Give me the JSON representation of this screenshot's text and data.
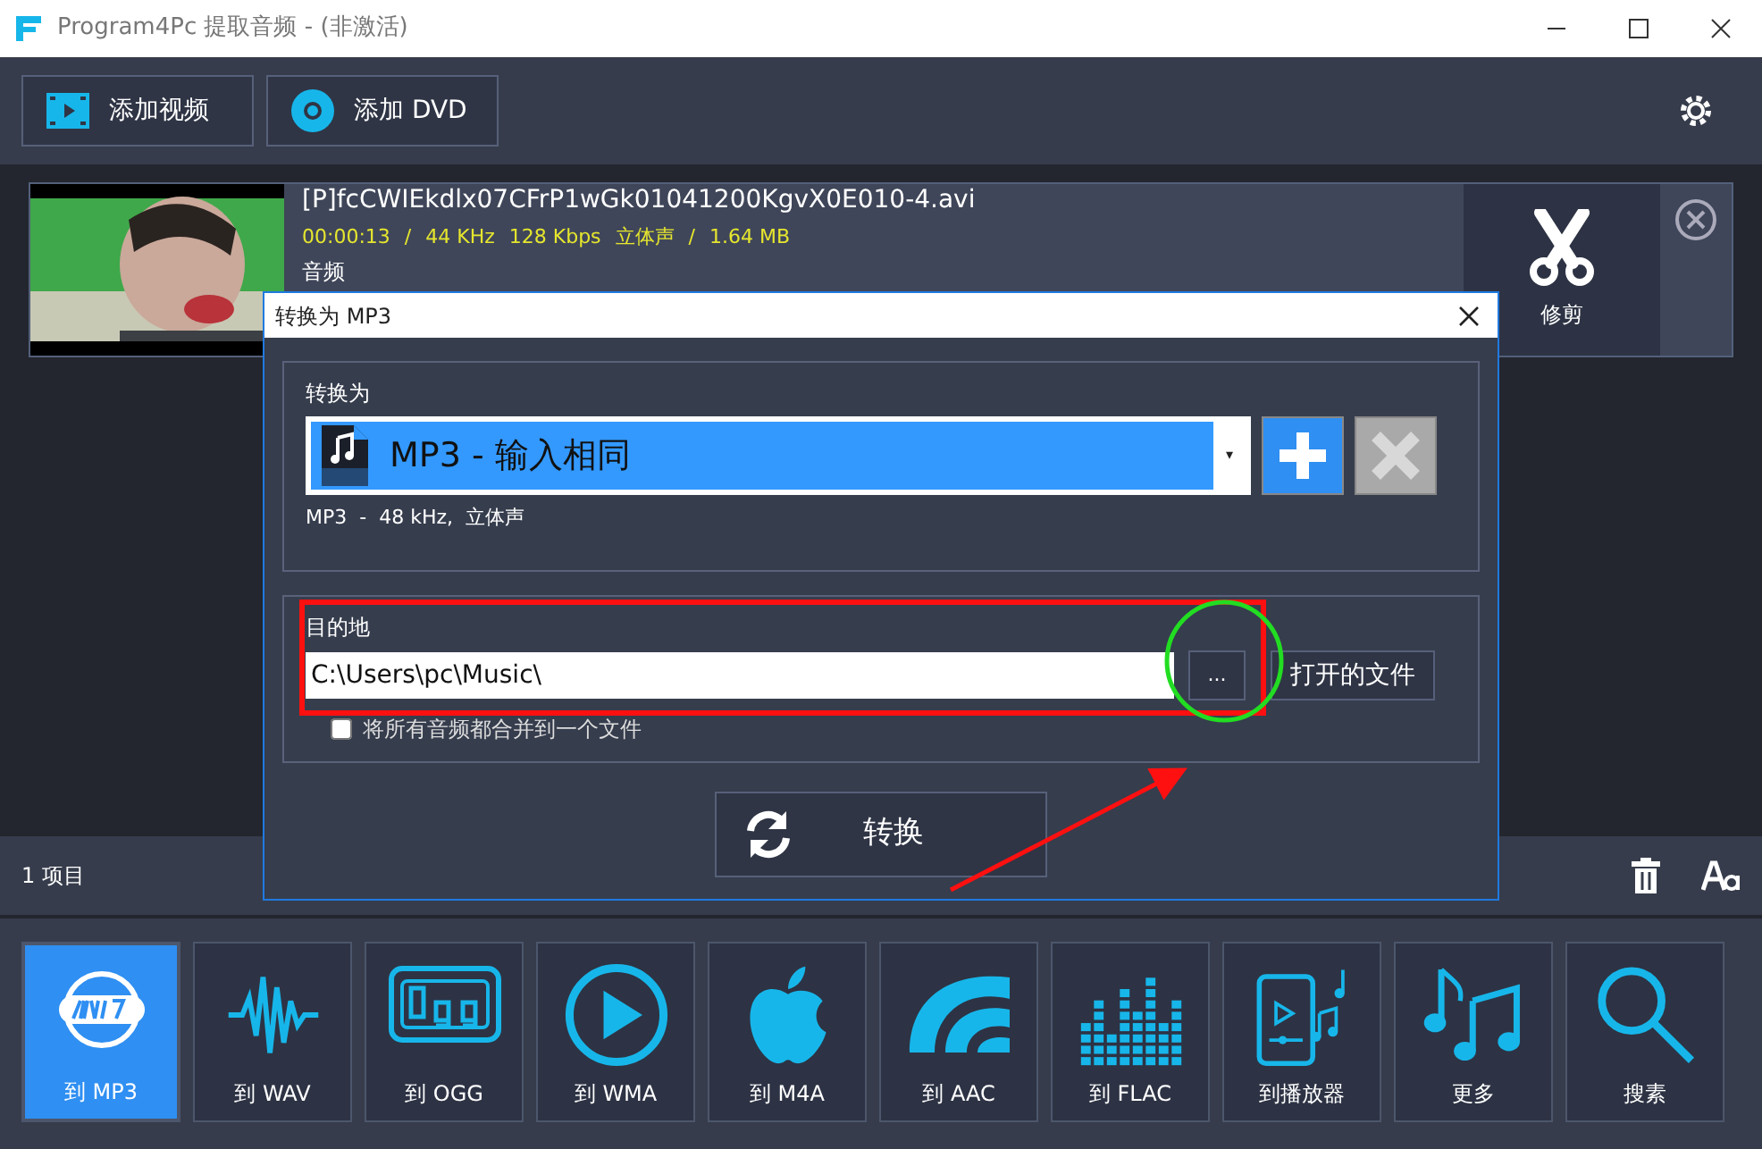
{
  "window": {
    "title": "Program4Pc 提取音频 - (非激活)"
  },
  "toolbar": {
    "buttons": [
      {
        "label": "添加视频",
        "kind": "video"
      },
      {
        "label": "添加 DVD",
        "kind": "dvd"
      }
    ]
  },
  "files": [
    {
      "kind": "picture",
      "name": "[P]fcCWIEkdlx07CFrP1wGk01041200KgvX0E010-4.avi",
      "duration": "00:00:13",
      "separator_1": "/",
      "separator_2": "/",
      "sample_rate": "44 KHz",
      "bitrate": "128 Kbps",
      "channels": "立体声",
      "size": "1.64 MB",
      "track": "音频",
      "trim_label": "修剪"
    }
  ],
  "status_bar": {
    "count": "1 项目"
  },
  "formats": [
    {
      "label": "到 MP3",
      "kind": "mp3",
      "selected": true
    },
    {
      "label": "到 WAV",
      "kind": "wave",
      "selected": false
    },
    {
      "label": "到 OGG",
      "kind": "ogg",
      "selected": false
    },
    {
      "label": "到 WMA",
      "kind": "play",
      "selected": false
    },
    {
      "label": "到 M4A",
      "kind": "apple",
      "selected": false
    },
    {
      "label": "到 AAC",
      "kind": "aac",
      "selected": false
    },
    {
      "label": "到 FLAC",
      "kind": "eq",
      "selected": false
    },
    {
      "label": "到播放器",
      "kind": "phone",
      "selected": false
    },
    {
      "label": "更多",
      "kind": "notes",
      "selected": false
    },
    {
      "label": "搜素",
      "kind": "search",
      "selected": false
    }
  ],
  "dialog": {
    "title": "转换为 MP3",
    "convert_to_label": "转换为",
    "profile": "MP3 - 输入相同",
    "dropdown_arrow": "▾",
    "profile_info": "MP3  -  48 kHz,  立体声",
    "remove_disabled": true,
    "destination_label": "目的地",
    "destination": "C:\\Users\\pc\\Music\\",
    "browse": "...",
    "open_folder": "打开的文件",
    "merge": {
      "label": "将所有音频都合并到一个文件",
      "checked": false
    },
    "convert": "转换"
  }
}
